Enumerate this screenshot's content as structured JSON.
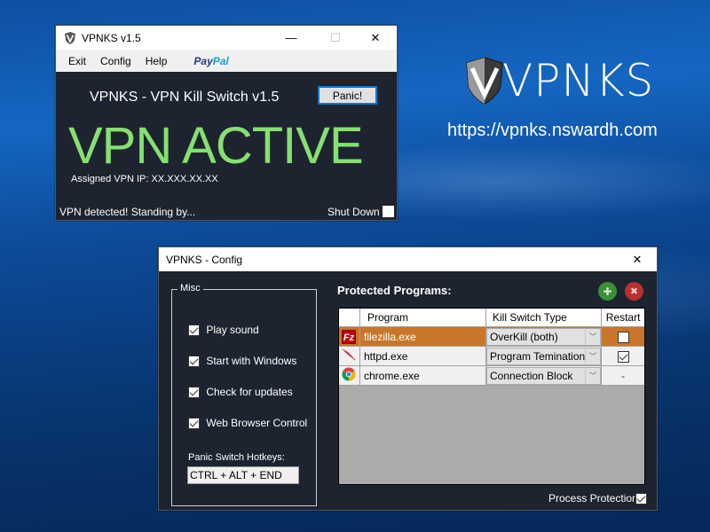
{
  "brand": {
    "logo_text": "VPNKS",
    "url": "https://vpnks.nswardh.com"
  },
  "main_window": {
    "title": "VPNKS v1.5",
    "controls": {
      "minimize": "—",
      "maximize": "☐",
      "close": "✕"
    },
    "menu": [
      "Exit",
      "Config",
      "Help"
    ],
    "paypal": {
      "part1": "Pay",
      "part2": "Pal"
    },
    "heading": "VPNKS - VPN Kill Switch v1.5",
    "panic_button": "Panic!",
    "status_big": "VPN ACTIVE",
    "assigned_ip_label": "Assigned VPN IP: XX.XXX.XX.XX",
    "status_bar": "VPN detected! Standing by...",
    "shutdown_label": "Shut Down",
    "shutdown_checked": false,
    "colors": {
      "status_green": "#86e070",
      "background": "#1d2430"
    }
  },
  "config_window": {
    "title": "VPNKS - Config",
    "close": "✕",
    "misc": {
      "group_label": "Misc",
      "options": [
        {
          "label": "Play sound",
          "checked": true
        },
        {
          "label": "Start with Windows",
          "checked": true
        },
        {
          "label": "Check for updates",
          "checked": true
        },
        {
          "label": "Web Browser Control",
          "checked": true
        }
      ],
      "hotkey_label": "Panic Switch Hotkeys:",
      "hotkey_value": "CTRL + ALT + END"
    },
    "programs": {
      "heading": "Protected Programs:",
      "add_icon": "✚",
      "remove_icon": "✖",
      "columns": [
        "",
        "Program",
        "Kill Switch Type",
        "Restart"
      ],
      "rows": [
        {
          "icon": "filezilla-icon",
          "program": "filezilla.exe",
          "type": "OverKill (both)",
          "restart": "unchecked",
          "selected": true
        },
        {
          "icon": "apache-feather-icon",
          "program": "httpd.exe",
          "type": "Program Temination",
          "restart": "checked",
          "selected": false
        },
        {
          "icon": "chrome-icon",
          "program": "chrome.exe",
          "type": "Connection Block",
          "restart": "-",
          "selected": false
        }
      ]
    },
    "process_protection_label": "Process Protection",
    "process_protection_checked": true
  }
}
